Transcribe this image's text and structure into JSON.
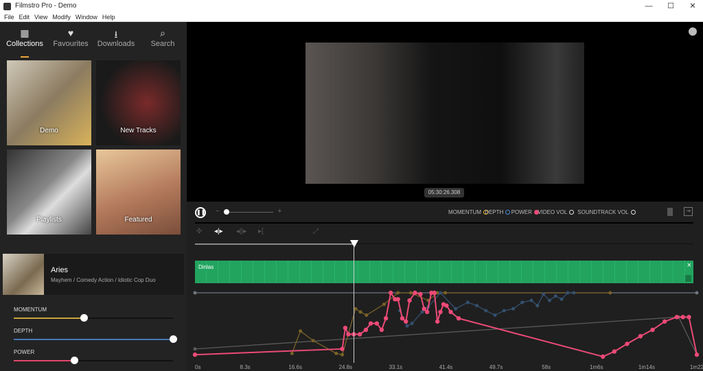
{
  "window": {
    "title": "Filmstro Pro - Demo",
    "minimize": "—",
    "maximize": "☐",
    "close": "✕"
  },
  "menu": [
    "File",
    "Edit",
    "View",
    "Modify",
    "Window",
    "Help"
  ],
  "tabs": [
    {
      "label": "Collections",
      "icon": "grid-icon",
      "glyph": "▦"
    },
    {
      "label": "Favourites",
      "icon": "heart-icon",
      "glyph": "♥"
    },
    {
      "label": "Downloads",
      "icon": "download-icon",
      "glyph": "⭳"
    },
    {
      "label": "Search",
      "icon": "search-icon",
      "glyph": "⌕"
    }
  ],
  "collections": [
    {
      "label": "Demo"
    },
    {
      "label": "New Tracks"
    },
    {
      "label": "Playlists"
    },
    {
      "label": "Featured"
    }
  ],
  "track": {
    "title": "Aries",
    "subtitle": "Mayhem / Comedy Action / Idiotic Cop Duo"
  },
  "sliders": [
    {
      "label": "MOMENTUM",
      "value": 0.44,
      "color": "#c9a53a"
    },
    {
      "label": "DEPTH",
      "value": 1.0,
      "color": "#4a77b4"
    },
    {
      "label": "POWER",
      "value": 0.38,
      "color": "#e5476e"
    }
  ],
  "video": {
    "timestamp": "05:30:26.308"
  },
  "legend": [
    {
      "label": "MOMENTUM",
      "color": "#e9b32a",
      "filled": false
    },
    {
      "label": "DEPTH",
      "color": "#4a8fe0",
      "filled": false
    },
    {
      "label": "POWER",
      "color": "#ec4a77",
      "filled": true
    },
    {
      "label": "VIDEO VOL",
      "color": "#dddddd",
      "filled": false
    },
    {
      "label": "SOUNDTRACK VOL",
      "color": "#dddddd",
      "filled": false
    }
  ],
  "clip": {
    "name": "Dinlas",
    "close": "×",
    "color": "#22a45f"
  },
  "playhead_seconds": 25.3,
  "chart_data": {
    "type": "line",
    "x_ticks": [
      "0s",
      "8.3s",
      "16.6s",
      "24.8s",
      "33.1s",
      "41.4s",
      "49.7s",
      "58s",
      "1m6s",
      "1m14s",
      "1m22"
    ],
    "xlim": [
      0,
      82.8
    ],
    "ylim": [
      0,
      100
    ],
    "series": [
      {
        "key": "video_vol",
        "color": "#6e7680",
        "values": [
          [
            0,
            100
          ],
          [
            82.8,
            100
          ]
        ]
      },
      {
        "key": "soundtrack_vol",
        "color": "#5a5a5a",
        "values": [
          [
            0,
            12
          ],
          [
            79.8,
            62
          ],
          [
            82.8,
            3
          ]
        ]
      },
      {
        "key": "momentum",
        "color": "#7a6228",
        "values": [
          [
            16,
            5
          ],
          [
            17.4,
            40
          ],
          [
            19.5,
            25
          ],
          [
            23.3,
            5
          ],
          [
            24.3,
            3
          ],
          [
            26.5,
            75
          ],
          [
            27.3,
            70
          ],
          [
            28.3,
            65
          ],
          [
            31.2,
            82
          ],
          [
            33.5,
            100
          ],
          [
            35.6,
            100
          ],
          [
            38.5,
            88
          ],
          [
            40,
            100
          ],
          [
            41.3,
            100
          ],
          [
            68.5,
            100
          ]
        ]
      },
      {
        "key": "depth",
        "color": "#34506e",
        "values": [
          [
            33.8,
            72
          ],
          [
            35,
            48
          ],
          [
            35.8,
            52
          ],
          [
            37.5,
            70
          ],
          [
            38.5,
            78
          ],
          [
            40.5,
            100
          ],
          [
            43,
            75
          ],
          [
            45,
            85
          ],
          [
            46.5,
            80
          ],
          [
            48,
            72
          ],
          [
            49.5,
            65
          ],
          [
            51,
            72
          ],
          [
            52.5,
            75
          ],
          [
            54,
            85
          ],
          [
            55.5,
            88
          ],
          [
            56.5,
            80
          ],
          [
            57.5,
            98
          ],
          [
            58.5,
            88
          ],
          [
            59.5,
            95
          ],
          [
            60.5,
            90
          ],
          [
            61.5,
            100
          ],
          [
            62.5,
            100
          ]
        ]
      },
      {
        "key": "power",
        "color": "#ec4a77",
        "values": [
          [
            0,
            3
          ],
          [
            24.3,
            12
          ],
          [
            24.8,
            45
          ],
          [
            25.3,
            35
          ],
          [
            26.2,
            35
          ],
          [
            27.2,
            35
          ],
          [
            28.2,
            42
          ],
          [
            29,
            52
          ],
          [
            30,
            52
          ],
          [
            30.8,
            42
          ],
          [
            31.5,
            60
          ],
          [
            32.3,
            100
          ],
          [
            33,
            90
          ],
          [
            33.5,
            90
          ],
          [
            34.2,
            60
          ],
          [
            34.8,
            55
          ],
          [
            35.4,
            88
          ],
          [
            36.3,
            100
          ],
          [
            37.2,
            98
          ],
          [
            37.8,
            75
          ],
          [
            38.3,
            70
          ],
          [
            39,
            100
          ],
          [
            39.5,
            100
          ],
          [
            40,
            55
          ],
          [
            40.5,
            70
          ],
          [
            41,
            82
          ],
          [
            41.5,
            80
          ],
          [
            42.2,
            70
          ],
          [
            43.5,
            60
          ],
          [
            67.3,
            0
          ],
          [
            69.2,
            8
          ],
          [
            71.3,
            20
          ],
          [
            73.5,
            32
          ],
          [
            75.5,
            42
          ],
          [
            77.5,
            55
          ],
          [
            79.5,
            62
          ],
          [
            80.5,
            62
          ],
          [
            81.5,
            62
          ],
          [
            82.8,
            3
          ]
        ]
      }
    ]
  }
}
